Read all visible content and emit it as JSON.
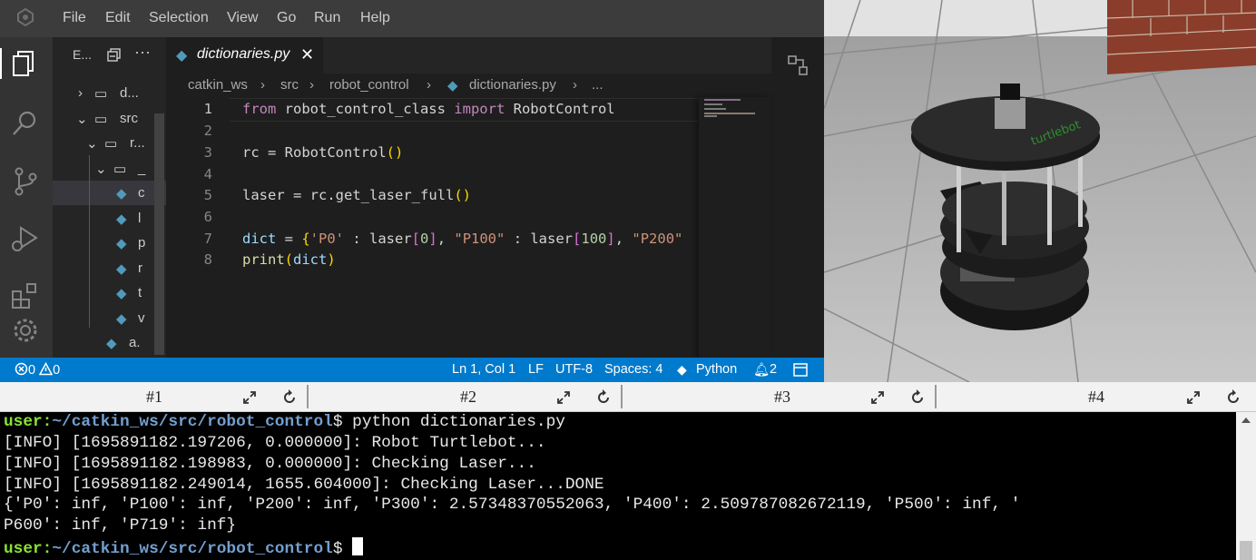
{
  "menubar": {
    "items": [
      "File",
      "Edit",
      "Selection",
      "View",
      "Go",
      "Run",
      "Help"
    ]
  },
  "activity_icons": [
    "explorer-icon",
    "search-icon",
    "source-control-icon",
    "run-debug-icon",
    "extensions-icon",
    "settings-gear-icon"
  ],
  "explorer": {
    "title": "E...",
    "rows": [
      {
        "label": "d...",
        "type": "folder"
      },
      {
        "label": "src",
        "type": "folder"
      },
      {
        "label": "r...",
        "type": "folder"
      },
      {
        "label": "_",
        "type": "folder"
      },
      {
        "label": "c",
        "type": "python-file"
      },
      {
        "label": "l",
        "type": "python-file"
      },
      {
        "label": "p",
        "type": "python-file"
      },
      {
        "label": "r",
        "type": "python-file"
      },
      {
        "label": "t",
        "type": "python-file"
      },
      {
        "label": "v",
        "type": "python-file"
      },
      {
        "label": "a.",
        "type": "python-file"
      }
    ]
  },
  "editor": {
    "tab_label": "dictionaries.py",
    "breadcrumb": [
      "catkin_ws",
      "src",
      "robot_control",
      "dictionaries.py",
      "..."
    ],
    "line_numbers": [
      "1",
      "2",
      "3",
      "4",
      "5",
      "6",
      "7",
      "8"
    ],
    "code": {
      "l1": {
        "k1": "from",
        "mod": " robot_control_class ",
        "k2": "import",
        "cls": " RobotControl"
      },
      "l3": {
        "v": "rc",
        "eq": " = ",
        "cls": "RobotControl",
        "o": "(",
        "c": ")"
      },
      "l5": {
        "v": "laser",
        "eq": " = rc.",
        "fn": "get_laser_full",
        "o": "(",
        "c": ")"
      },
      "l7": {
        "v": "dict",
        "eq": " = ",
        "o": "{",
        "s1": "'P0'",
        "t1": " : laser",
        "b1o": "[",
        "n1": "0",
        "b1c": "]",
        "t2": ", ",
        "s2": "\"P100\"",
        "t3": " : laser",
        "b2o": "[",
        "n2": "100",
        "b2c": "]",
        "t4": ", ",
        "s3": "\"P200\""
      },
      "l8": {
        "fn": "print",
        "o": "(",
        "v": "dict",
        "c": ")"
      }
    }
  },
  "statusbar": {
    "errors": "0",
    "warnings": "0",
    "position": "Ln 1, Col 1",
    "eol": "LF",
    "encoding": "UTF-8",
    "spaces": "Spaces: 4",
    "language": "Python",
    "notifications": "2"
  },
  "terminal_tabs": [
    "#1",
    "#2",
    "#3",
    "#4"
  ],
  "terminal": {
    "prompt_user": "user:",
    "prompt_path": "~/catkin_ws/src/robot_control",
    "prompt_symbol": "$",
    "command": " python dictionaries.py",
    "output": [
      "[INFO] [1695891182.197206, 0.000000]: Robot Turtlebot...",
      "[INFO] [1695891182.198983, 0.000000]: Checking Laser...",
      "[INFO] [1695891182.249014, 1655.604000]: Checking Laser...DONE",
      "{'P0': inf, 'P100': inf, 'P200': inf, 'P300': 2.57348370552063, 'P400': 2.509787082672119, 'P500': inf, '",
      "P600': inf, 'P719': inf}"
    ]
  },
  "colors": {
    "statusbar": "#007acc",
    "prompt_user": "#8ae234",
    "prompt_path": "#729fcf"
  }
}
